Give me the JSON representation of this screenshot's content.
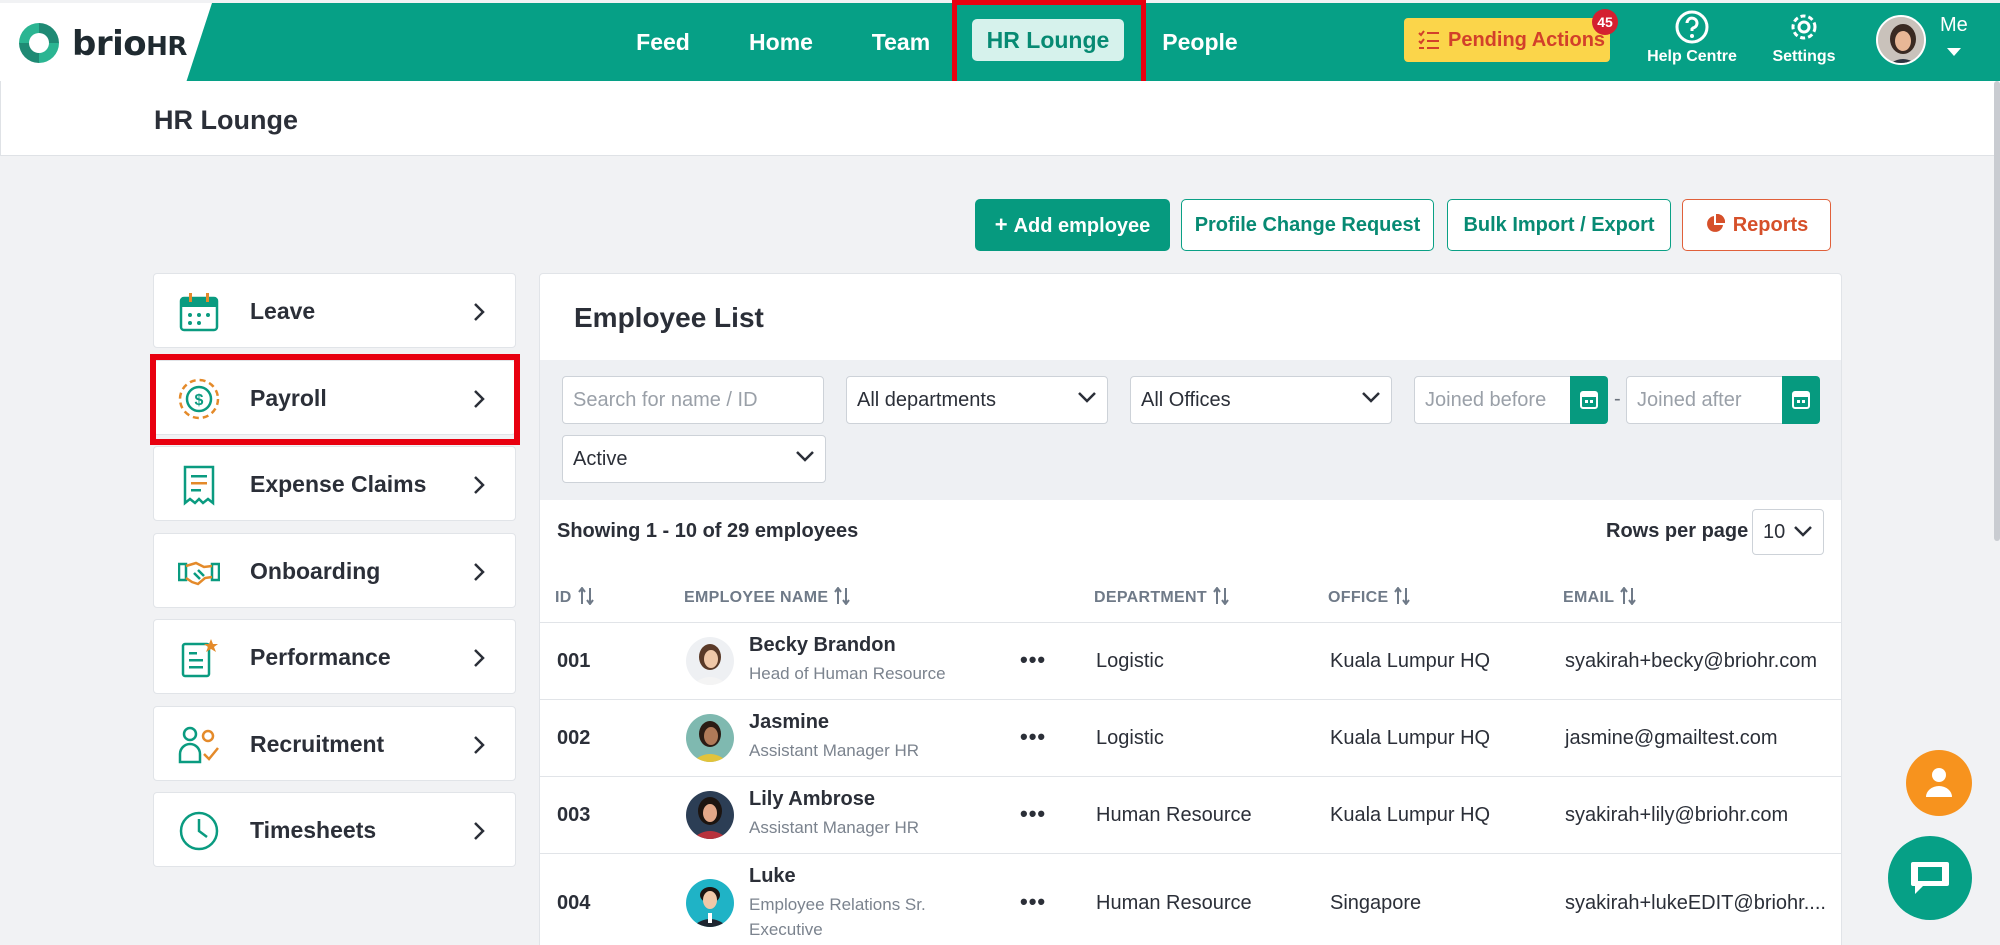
{
  "app": {
    "logo_text": "brio",
    "logo_suffix": "HR",
    "brand_color": "#06a086"
  },
  "nav": {
    "items": [
      {
        "label": "Feed"
      },
      {
        "label": "Home"
      },
      {
        "label": "Team"
      },
      {
        "label": "HR Lounge",
        "active": true
      },
      {
        "label": "People"
      }
    ],
    "pending_label": "Pending Actions",
    "pending_count": "45",
    "help_label": "Help Centre",
    "settings_label": "Settings",
    "me_label": "Me"
  },
  "page": {
    "title": "HR Lounge"
  },
  "actions": {
    "add_employee": "Add employee",
    "profile_change": "Profile Change Request",
    "bulk": "Bulk Import / Export",
    "reports": "Reports"
  },
  "sidebar": {
    "items": [
      {
        "label": "Leave",
        "icon": "calendar-icon"
      },
      {
        "label": "Payroll",
        "icon": "dollar-coin-icon",
        "highlighted": true
      },
      {
        "label": "Expense Claims",
        "icon": "receipt-icon"
      },
      {
        "label": "Onboarding",
        "icon": "handshake-icon"
      },
      {
        "label": "Performance",
        "icon": "clipboard-star-icon"
      },
      {
        "label": "Recruitment",
        "icon": "people-check-icon"
      },
      {
        "label": "Timesheets",
        "icon": "clock-icon"
      }
    ]
  },
  "employee_list": {
    "title": "Employee List",
    "filters": {
      "search_placeholder": "Search for name / ID",
      "department": "All departments",
      "office": "All Offices",
      "joined_before_placeholder": "Joined before",
      "joined_after_placeholder": "Joined after",
      "separator": "-",
      "status": "Active"
    },
    "showing": "Showing 1 - 10 of 29 employees",
    "rows_per_page_label": "Rows per page",
    "rows_per_page": "10",
    "columns": [
      "ID",
      "EMPLOYEE NAME",
      "DEPARTMENT",
      "OFFICE",
      "EMAIL"
    ],
    "rows": [
      {
        "id": "001",
        "name": "Becky Brandon",
        "title": "Head of Human Resource",
        "department": "Logistic",
        "office": "Kuala Lumpur HQ",
        "email": "syakirah+becky@briohr.com"
      },
      {
        "id": "002",
        "name": "Jasmine",
        "title": "Assistant Manager HR",
        "department": "Logistic",
        "office": "Kuala Lumpur HQ",
        "email": "jasmine@gmailtest.com"
      },
      {
        "id": "003",
        "name": "Lily Ambrose",
        "title": "Assistant Manager HR",
        "department": "Human Resource",
        "office": "Kuala Lumpur HQ",
        "email": "syakirah+lily@briohr.com"
      },
      {
        "id": "004",
        "name": "Luke",
        "title": "Employee Relations Sr. Executive",
        "department": "Human Resource",
        "office": "Singapore",
        "email": "syakirah+lukeEDIT@briohr...."
      }
    ],
    "more_label": "•••"
  }
}
